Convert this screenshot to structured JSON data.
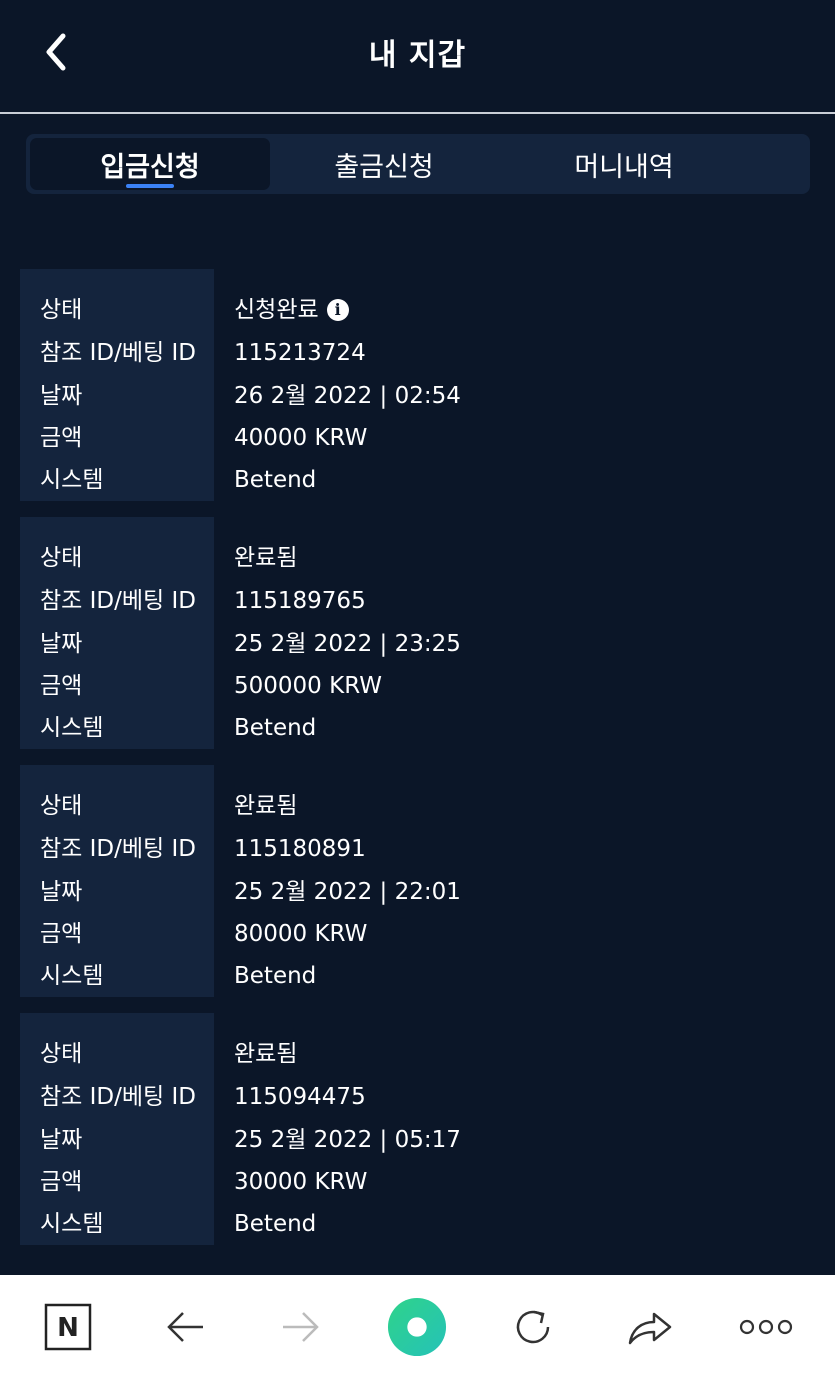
{
  "header": {
    "title": "내 지갑"
  },
  "tabs": [
    {
      "label": "입금신청"
    },
    {
      "label": "출금신청"
    },
    {
      "label": "머니내역"
    }
  ],
  "labels": {
    "status": "상태",
    "ref": "참조 ID/베팅 ID",
    "date": "날짜",
    "amount": "금액",
    "system": "시스템"
  },
  "records": [
    {
      "status": "신청완료",
      "ref": "115213724",
      "date": "26 2월 2022 | 02:54",
      "amount": "40000 KRW",
      "system": "Betend"
    },
    {
      "status": "완료됨",
      "ref": "115189765",
      "date": "25 2월 2022 | 23:25",
      "amount": "500000 KRW",
      "system": "Betend"
    },
    {
      "status": "완료됨",
      "ref": "115180891",
      "date": "25 2월 2022 | 22:01",
      "amount": "80000 KRW",
      "system": "Betend"
    },
    {
      "status": "완료됨",
      "ref": "115094475",
      "date": "25 2월 2022 | 05:17",
      "amount": "30000 KRW",
      "system": "Betend"
    }
  ],
  "browser_bar": {
    "icons": [
      "naver-n-icon",
      "back-arrow-icon",
      "forward-arrow-icon",
      "home-green-icon",
      "refresh-icon",
      "share-icon",
      "more-icon"
    ],
    "n_label": "N",
    "accent": "#2fd38a"
  }
}
